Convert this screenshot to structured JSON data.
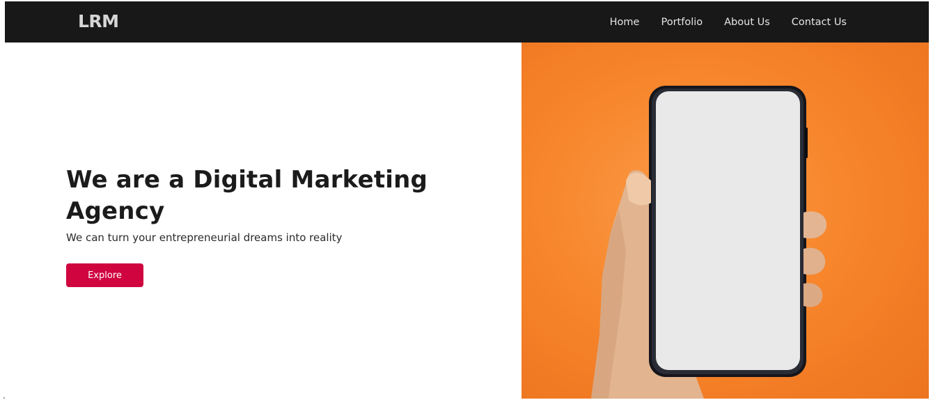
{
  "navbar": {
    "brand": "LRM",
    "links": [
      "Home",
      "Portfolio",
      "About Us",
      "Contact Us"
    ]
  },
  "hero": {
    "title": "We are a Digital Marketing Agency",
    "subtitle": "We can turn your entrepreneurial dreams into reality",
    "button_label": "Explore"
  },
  "colors": {
    "navbar_bg": "#181818",
    "accent": "#d0043f",
    "hero_image_bg": "#f7862c"
  },
  "images": {
    "hero": "hand-holding-smartphone-image"
  }
}
